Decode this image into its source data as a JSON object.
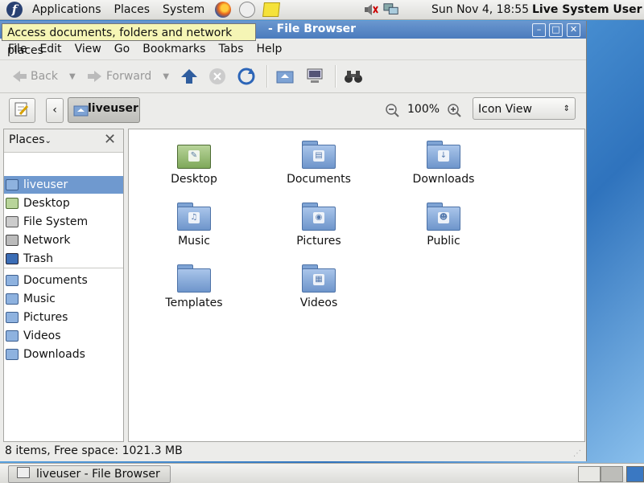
{
  "top_panel": {
    "menus": [
      "Applications",
      "Places",
      "System"
    ],
    "clock": "Sun Nov  4, 18:55",
    "user": "Live System User"
  },
  "tooltip": "Access documents, folders and network places",
  "window": {
    "title": "- File Browser",
    "menubar": [
      "File",
      "Edit",
      "View",
      "Go",
      "Bookmarks",
      "Tabs",
      "Help"
    ],
    "toolbar": {
      "back": "Back",
      "forward": "Forward"
    },
    "location": {
      "crumb": "liveuser",
      "zoom": "100%",
      "view_mode": "Icon View"
    },
    "sidebar": {
      "header": "Places",
      "items": [
        "liveuser",
        "Desktop",
        "File System",
        "Network",
        "Trash"
      ],
      "bookmarks": [
        "Documents",
        "Music",
        "Pictures",
        "Videos",
        "Downloads"
      ]
    },
    "files": [
      "Desktop",
      "Documents",
      "Downloads",
      "Music",
      "Pictures",
      "Public",
      "Templates",
      "Videos"
    ],
    "status": "8 items, Free space: 1021.3 MB"
  },
  "taskbar": {
    "task": "liveuser - File Browser"
  }
}
